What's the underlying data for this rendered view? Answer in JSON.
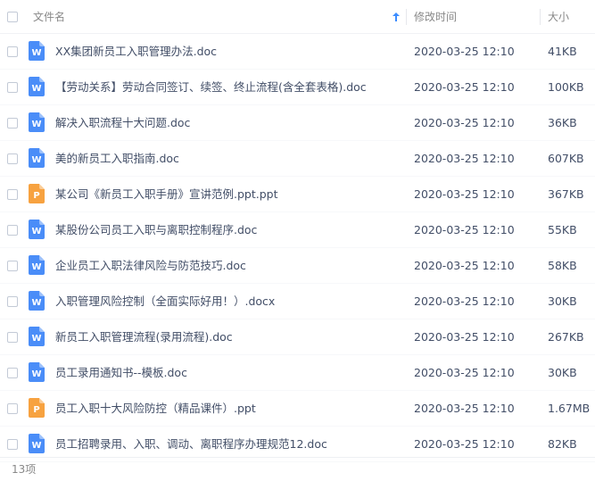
{
  "header": {
    "col_name": "文件名",
    "col_time": "修改时间",
    "col_size": "大小",
    "sort_icon": "arrow-up-icon"
  },
  "colors": {
    "word_icon": "#4a8df8",
    "ppt_icon": "#f7a240",
    "sort_arrow": "#3b8cff",
    "text": "#424e67"
  },
  "files": [
    {
      "name": "XX集团新员工入职管理办法.doc",
      "type": "word",
      "icon_letter": "W",
      "modified": "2020-03-25 12:10",
      "size": "41KB"
    },
    {
      "name": "【劳动关系】劳动合同签订、续签、终止流程(含全套表格).doc",
      "type": "word",
      "icon_letter": "W",
      "modified": "2020-03-25 12:10",
      "size": "100KB"
    },
    {
      "name": "解决入职流程十大问题.doc",
      "type": "word",
      "icon_letter": "W",
      "modified": "2020-03-25 12:10",
      "size": "36KB"
    },
    {
      "name": "美的新员工入职指南.doc",
      "type": "word",
      "icon_letter": "W",
      "modified": "2020-03-25 12:10",
      "size": "607KB"
    },
    {
      "name": "某公司《新员工入职手册》宣讲范例.ppt.ppt",
      "type": "ppt",
      "icon_letter": "P",
      "modified": "2020-03-25 12:10",
      "size": "367KB"
    },
    {
      "name": "某股份公司员工入职与离职控制程序.doc",
      "type": "word",
      "icon_letter": "W",
      "modified": "2020-03-25 12:10",
      "size": "55KB"
    },
    {
      "name": "企业员工入职法律风险与防范技巧.doc",
      "type": "word",
      "icon_letter": "W",
      "modified": "2020-03-25 12:10",
      "size": "58KB"
    },
    {
      "name": "入职管理风险控制（全面实际好用！）.docx",
      "type": "word",
      "icon_letter": "W",
      "modified": "2020-03-25 12:10",
      "size": "30KB"
    },
    {
      "name": "新员工入职管理流程(录用流程).doc",
      "type": "word",
      "icon_letter": "W",
      "modified": "2020-03-25 12:10",
      "size": "267KB"
    },
    {
      "name": "员工录用通知书--模板.doc",
      "type": "word",
      "icon_letter": "W",
      "modified": "2020-03-25 12:10",
      "size": "30KB"
    },
    {
      "name": "员工入职十大风险防控（精品课件）.ppt",
      "type": "ppt",
      "icon_letter": "P",
      "modified": "2020-03-25 12:10",
      "size": "1.67MB"
    },
    {
      "name": "员工招聘录用、入职、调动、离职程序办理规范12.doc",
      "type": "word",
      "icon_letter": "W",
      "modified": "2020-03-25 12:10",
      "size": "82KB"
    }
  ],
  "footer": {
    "count": "13项"
  }
}
